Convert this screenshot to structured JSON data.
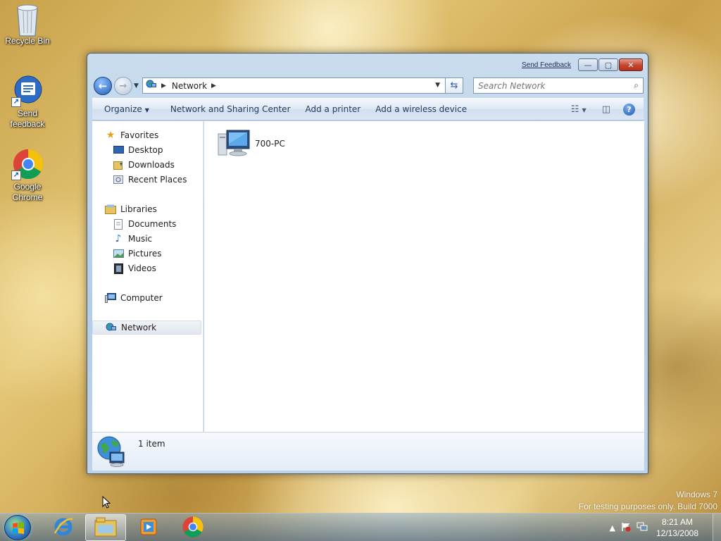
{
  "desktop": {
    "icons": [
      {
        "label": "Recycle Bin",
        "icon": "recycle-bin-icon"
      },
      {
        "label": "Send feedback",
        "icon": "send-feedback-icon"
      },
      {
        "label": "Google Chrome",
        "icon": "chrome-icon"
      }
    ],
    "watermark": {
      "line1": "Windows 7",
      "line2": "For testing purposes only. Build 7000"
    }
  },
  "window": {
    "send_feedback": "Send Feedback",
    "caption_buttons": {
      "minimize": "—",
      "maximize": "▢",
      "close": "✕"
    },
    "address": {
      "root_icon": "network-icon",
      "crumb": "Network"
    },
    "search": {
      "placeholder": "Search Network"
    },
    "toolbar": {
      "organize": "Organize",
      "network_sharing": "Network and Sharing Center",
      "add_printer": "Add a printer",
      "add_wireless": "Add a wireless device"
    },
    "nav_pane": {
      "favorites": "Favorites",
      "desktop": "Desktop",
      "downloads": "Downloads",
      "recent_places": "Recent Places",
      "libraries": "Libraries",
      "documents": "Documents",
      "music": "Music",
      "pictures": "Pictures",
      "videos": "Videos",
      "computer": "Computer",
      "network": "Network"
    },
    "content": {
      "items": [
        {
          "label": "700-PC",
          "icon": "computer-icon"
        }
      ]
    },
    "details": {
      "count": "1 item"
    }
  },
  "taskbar": {
    "apps": [
      "internet-explorer-icon",
      "windows-explorer-icon",
      "media-player-icon",
      "chrome-icon"
    ],
    "clock": {
      "time": "8:21 AM",
      "date": "12/13/2008"
    }
  },
  "colors": {
    "accent": "#2460b8",
    "title_bar": "#b4cde6"
  }
}
